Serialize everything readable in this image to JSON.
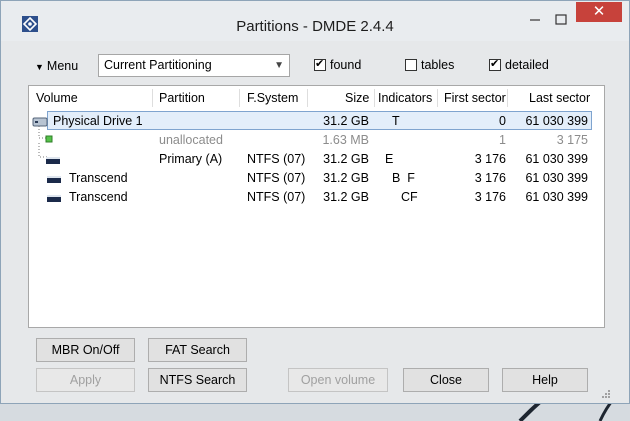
{
  "window": {
    "title": "Partitions - DMDE 2.4.4"
  },
  "titlebar_buttons": {
    "close_glyph": "✕"
  },
  "toolbar": {
    "menu_label": "Menu",
    "partitioning_select": "Current Partitioning",
    "checkboxes": [
      {
        "label": "found",
        "checked": true
      },
      {
        "label": "tables",
        "checked": false
      },
      {
        "label": "detailed",
        "checked": true
      }
    ]
  },
  "table": {
    "columns": [
      "Volume",
      "Partition",
      "F.System",
      "Size",
      "Indicators",
      "First sector",
      "Last sector"
    ],
    "rows": [
      {
        "volume": "Physical Drive 1",
        "partition": "",
        "fs": "",
        "size": "31.2 GB",
        "indicators": "T",
        "first": "0",
        "last": "61 030 399",
        "selected": true,
        "icon": "physical-drive-icon"
      },
      {
        "volume": "",
        "partition": "unallocated",
        "fs": "",
        "size": "1.63 MB",
        "indicators": "",
        "first": "1",
        "last": "3 175",
        "muted": true,
        "icon": "unallocated-icon"
      },
      {
        "volume": "",
        "partition": "Primary (A)",
        "fs": "NTFS (07)",
        "size": "31.2 GB",
        "indicators": "E",
        "first": "3 176",
        "last": "61 030 399",
        "icon": "partition-icon"
      },
      {
        "volume": "Transcend",
        "partition": "",
        "fs": "NTFS (07)",
        "size": "31.2 GB",
        "indicators": "B  F",
        "first": "3 176",
        "last": "61 030 399",
        "icon": "volume-icon"
      },
      {
        "volume": "Transcend",
        "partition": "",
        "fs": "NTFS (07)",
        "size": "31.2 GB",
        "indicators": "CF",
        "first": "3 176",
        "last": "61 030 399",
        "icon": "volume-icon"
      }
    ]
  },
  "buttons": {
    "mbr_onoff": "MBR On/Off",
    "fat_search": "FAT Search",
    "apply": "Apply",
    "ntfs_search": "NTFS Search",
    "open_volume": "Open volume",
    "close": "Close",
    "help": "Help"
  }
}
